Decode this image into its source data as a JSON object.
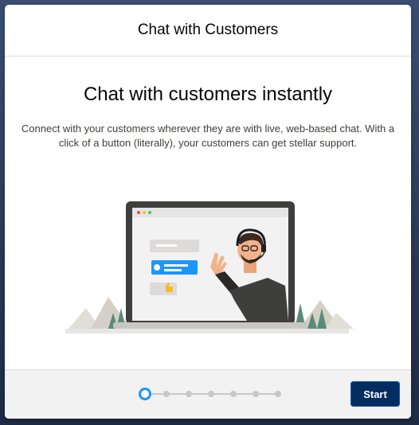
{
  "modal": {
    "title": "Chat with Customers",
    "headline": "Chat with customers instantly",
    "description": "Connect with your customers wherever they are with live, web-based chat. With a click of a button (literally), your customers can get stellar support."
  },
  "footer": {
    "progress": {
      "total_steps": 7,
      "current_step": 1
    },
    "start_label": "Start"
  },
  "colors": {
    "primary_button": "#032d60",
    "progress_active": "#1b96ff",
    "progress_inactive": "#c9c7c5",
    "chat_bubble_blue": "#1b96ff",
    "chat_bubble_gray": "#dddbda",
    "thumbs_up_yellow": "#f4bc25"
  },
  "icons": {
    "illustration": "laptop-chat-agent-illustration",
    "thumbs_up": "thumbs-up-icon",
    "reply": "reply-icon"
  }
}
